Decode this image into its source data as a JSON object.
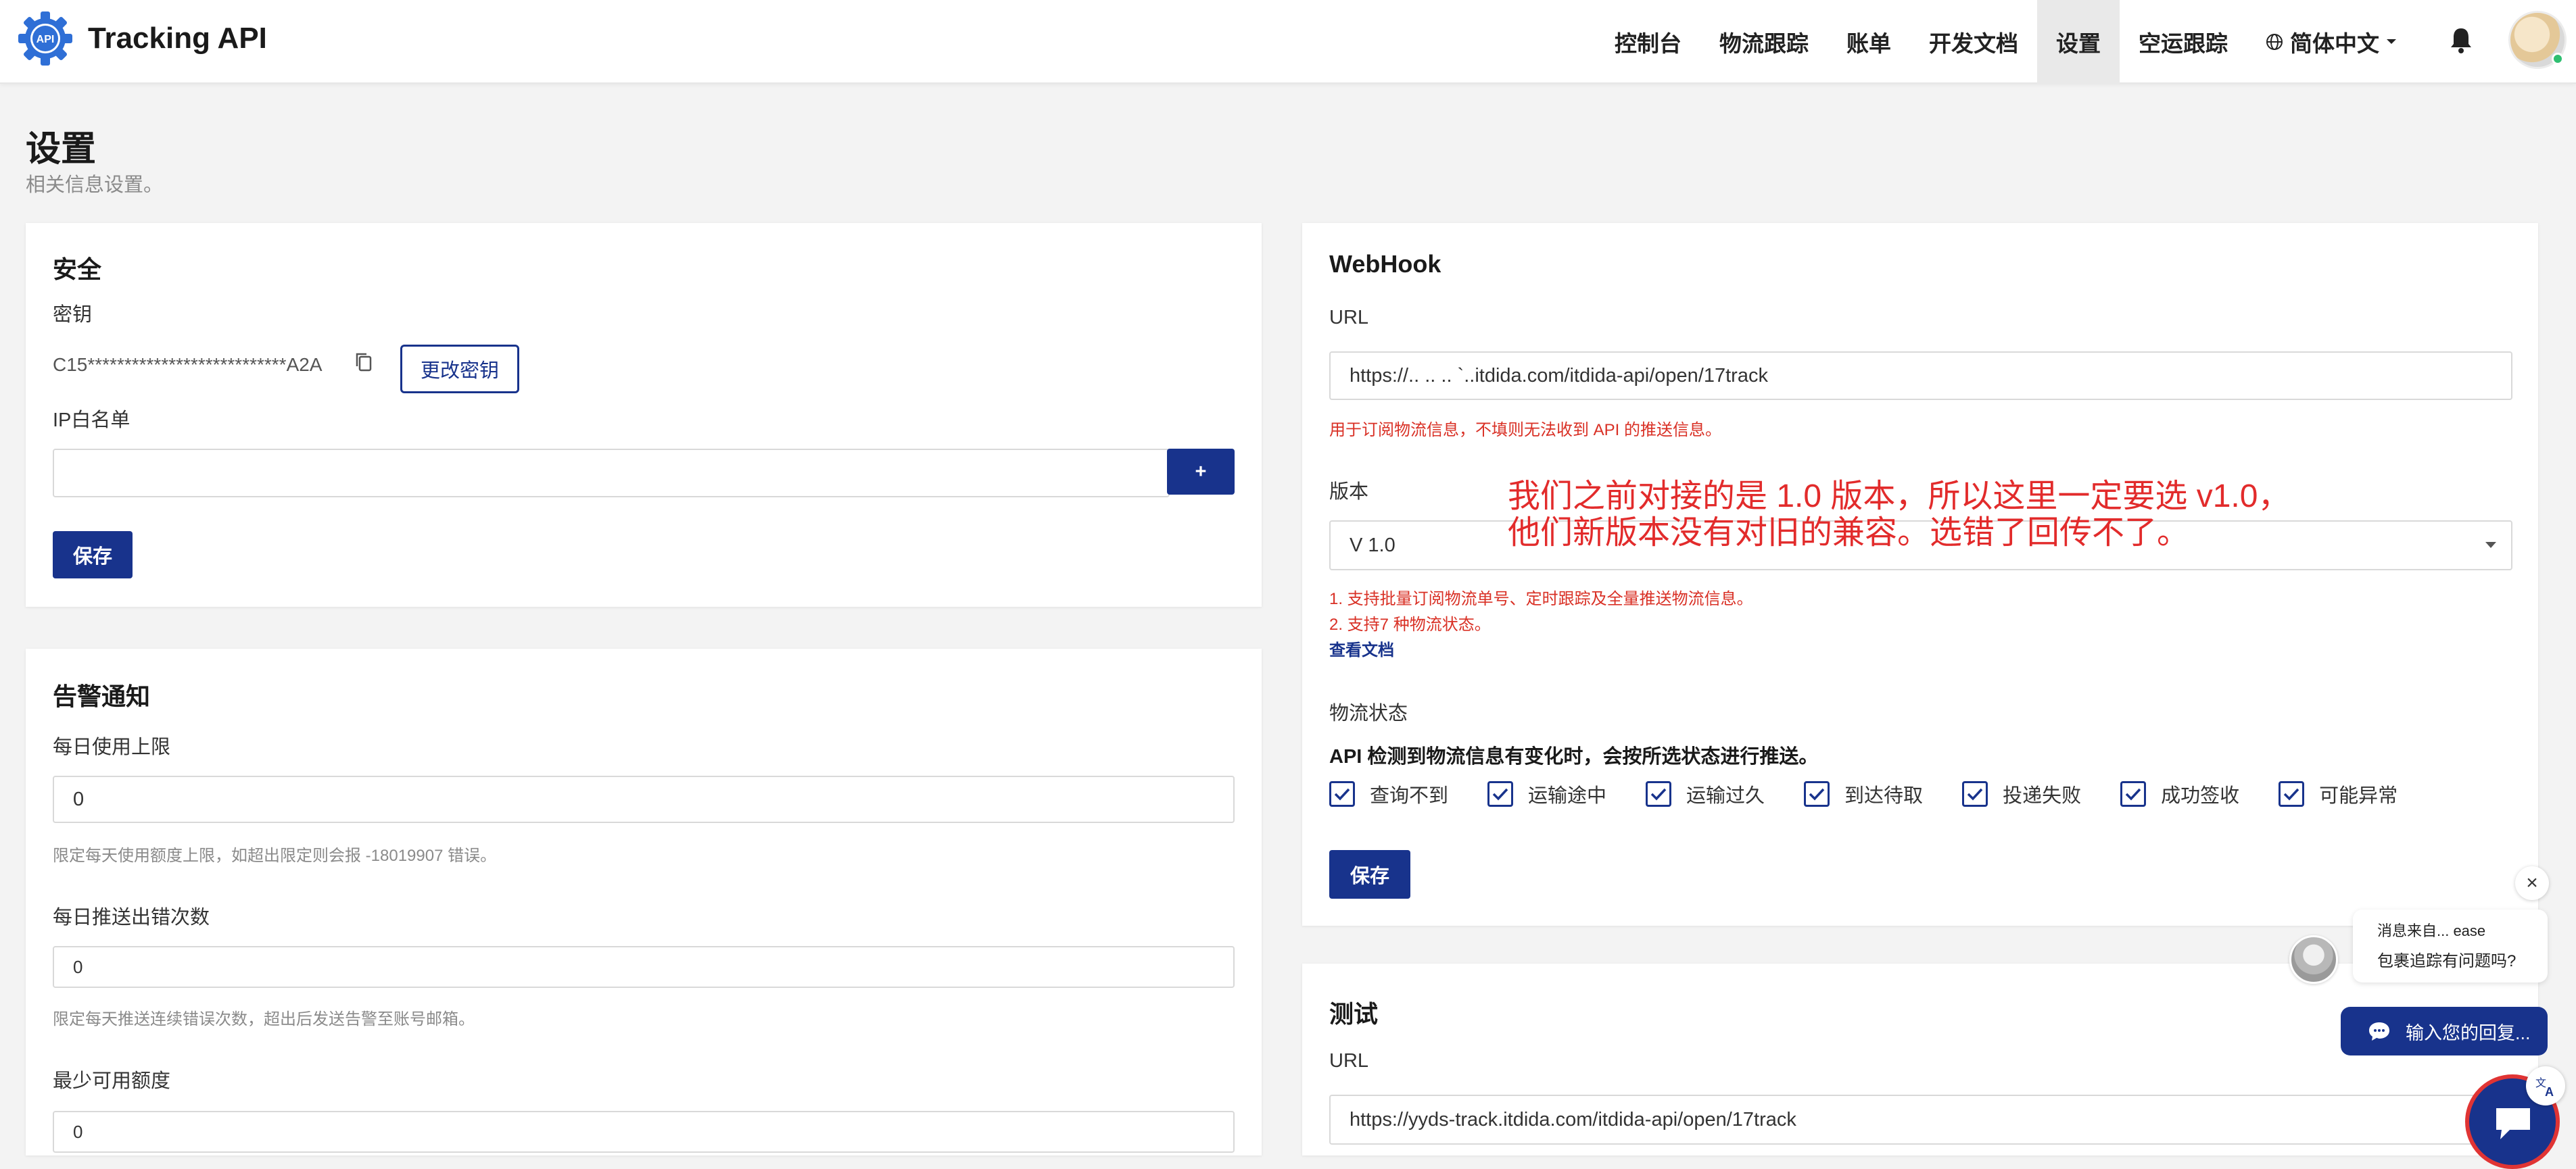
{
  "header": {
    "logo_text": "API",
    "brand": "Tracking API",
    "nav": [
      {
        "label": "控制台"
      },
      {
        "label": "物流跟踪"
      },
      {
        "label": "账单"
      },
      {
        "label": "开发文档"
      },
      {
        "label": "设置",
        "active": true
      },
      {
        "label": "空运跟踪"
      }
    ],
    "language": "简体中文",
    "icons": {
      "language": "globe-icon",
      "notifications": "bell-icon"
    }
  },
  "page": {
    "title": "设置",
    "subtitle": "相关信息设置。"
  },
  "security": {
    "title": "安全",
    "key_label": "密钥",
    "key_value": "C15***************************A2A",
    "change_key_label": "更改密钥",
    "ip_label": "IP白名单",
    "ip_value": "",
    "add_label": "+",
    "save_label": "保存"
  },
  "alerts": {
    "title": "告警通知",
    "daily_limit_label": "每日使用上限",
    "daily_limit_value": "0",
    "daily_limit_hint": "限定每天使用额度上限，如超出限定则会报 -18019907 错误。",
    "push_errors_label": "每日推送出错次数",
    "push_errors_value": "0",
    "push_errors_hint": "限定每天推送连续错误次数，超出后发送告警至账号邮箱。",
    "min_quota_label": "最少可用额度",
    "min_quota_value": "0"
  },
  "webhook": {
    "title": "WebHook",
    "url_label": "URL",
    "url_value": "https://.. ..  ..  `..itdida.com/itdida-api/open/17track",
    "url_note": "用于订阅物流信息，不填则无法收到 API 的推送信息。",
    "version_label": "版本",
    "version_value": "V 1.0",
    "version_notes": [
      "1. 支持批量订阅物流单号、定时跟踪及全量推送物流信息。",
      "2. 支持7 种物流状态。"
    ],
    "docs_link": "查看文档",
    "status_label": "物流状态",
    "status_desc": "API 检测到物流信息有变化时，会按所选状态进行推送。",
    "statuses": [
      {
        "label": "查询不到",
        "checked": true
      },
      {
        "label": "运输途中",
        "checked": true
      },
      {
        "label": "运输过久",
        "checked": true
      },
      {
        "label": "到达待取",
        "checked": true
      },
      {
        "label": "投递失败",
        "checked": true
      },
      {
        "label": "成功签收",
        "checked": true
      },
      {
        "label": "可能异常",
        "checked": true
      }
    ],
    "save_label": "保存"
  },
  "test": {
    "title": "测试",
    "url_label": "URL",
    "url_value": "https://yyds-track.itdida.com/itdida-api/open/17track"
  },
  "annotation": {
    "line1": "我们之前对接的是 1.0 版本，所以这里一定要选 v1.0，",
    "line2": "他们新版本没有对旧的兼容。选错了回传不了。"
  },
  "chat": {
    "sender": "消息来自... ease",
    "message": "包裹追踪有问题吗?",
    "reply_label": "输入您的回复...",
    "close_label": "×"
  },
  "colors": {
    "primary": "#18338c",
    "error": "#d93025",
    "annotation": "#e22b2b"
  }
}
